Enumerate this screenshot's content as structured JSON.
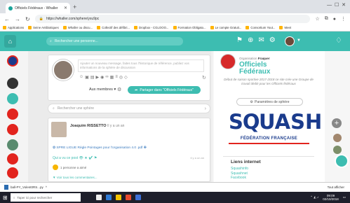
{
  "browser": {
    "tab_title": "Officiels Fédéraux - Whaller",
    "url": "https://whaller.com/sphere/yxu9pc",
    "bookmarks": [
      "Applications",
      "Seine Antibiotiques",
      "Whaller ou discu...",
      "Collectif des défibri...",
      "Dropbox - CGLOOO...",
      "Formation Obligato...",
      "Le compte Gratuit...",
      "Consortium Yout...",
      "Meet"
    ]
  },
  "app": {
    "search_placeholder": "Rechercher une personne...",
    "header_icons": [
      "flag-icon",
      "sign-icon",
      "mail-icon",
      "gear-icon"
    ]
  },
  "composer": {
    "placeholder": "Ajouter un nouveau message, faites tous l'historique de référence, publiez vos informations de la sphère de discussion",
    "audience": "Aux membres",
    "share_label": "Partager dans \"Officiels Fédéraux\""
  },
  "filter": {
    "placeholder": "Rechercher une sphère"
  },
  "post": {
    "author": "Joaquim RISSETTO",
    "time": "Il y a un an",
    "body": "✿ SPRE LIGUE Règle Pointages pour l'organisation 4.0 .pdf ✤",
    "actions": "Qui a vu ce post 👁 ★ ✔ ⚑",
    "date": "il y a un an",
    "comment": "1 personne a aimé",
    "more": "▼ Voir tous les commentaires..."
  },
  "sidebar_right": {
    "org_label": "Organisation",
    "org_name": "Fraquer",
    "title_line1": "Officiels",
    "title_line2": "Fédéraux",
    "description": "Début de saison sportive 2017-2018 ce site crée une Groupe de travail dédié pour les Officiels fédéraux",
    "params_label": "Paramètres de sphère",
    "logo_word_a": "SQ",
    "logo_word_b": "UASH",
    "logo_sub": "FÉDÉRATION FRANÇAISE",
    "links_heading": "Liens internet",
    "links": [
      "Squashinfo",
      "Squashnet",
      "Facebook"
    ]
  },
  "downloads": {
    "file": "ball-PY_Volent0RS...py",
    "show_all": "Tout afficher"
  },
  "taskbar": {
    "search": "Taper ici pour rechercher",
    "time": "09:09",
    "date": "02/10/2018"
  }
}
